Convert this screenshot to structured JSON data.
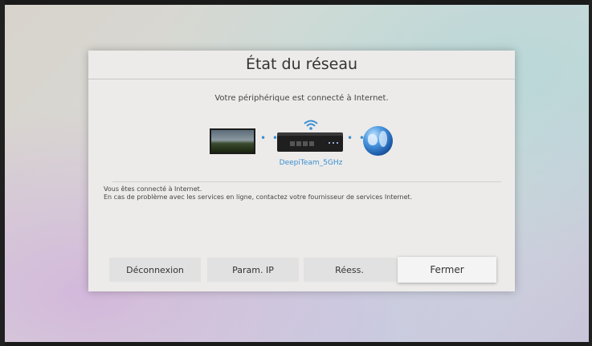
{
  "dialog": {
    "title": "État du réseau",
    "subtitle": "Votre périphérique est connecté à Internet.",
    "device_name": "DeepiTeam_5GHz",
    "dots_left": "• • •",
    "dots_right": "• • •",
    "info_lines": [
      "Vous êtes connecté à Internet.",
      "En cas de problème avec les services en ligne, contactez votre fournisseur de services Internet."
    ],
    "icons": [
      "tv-icon",
      "router-icon",
      "wifi-icon",
      "globe-icon"
    ]
  },
  "buttons": {
    "disconnect": "Déconnexion",
    "ip_settings": "Param. IP",
    "retry": "Réess.",
    "close": "Fermer"
  },
  "colors": {
    "accent": "#3a8fd0",
    "dialog_bg": "#ecebea",
    "button_bg": "#e1e1e1",
    "focused_button_bg": "#f4f4f4"
  }
}
